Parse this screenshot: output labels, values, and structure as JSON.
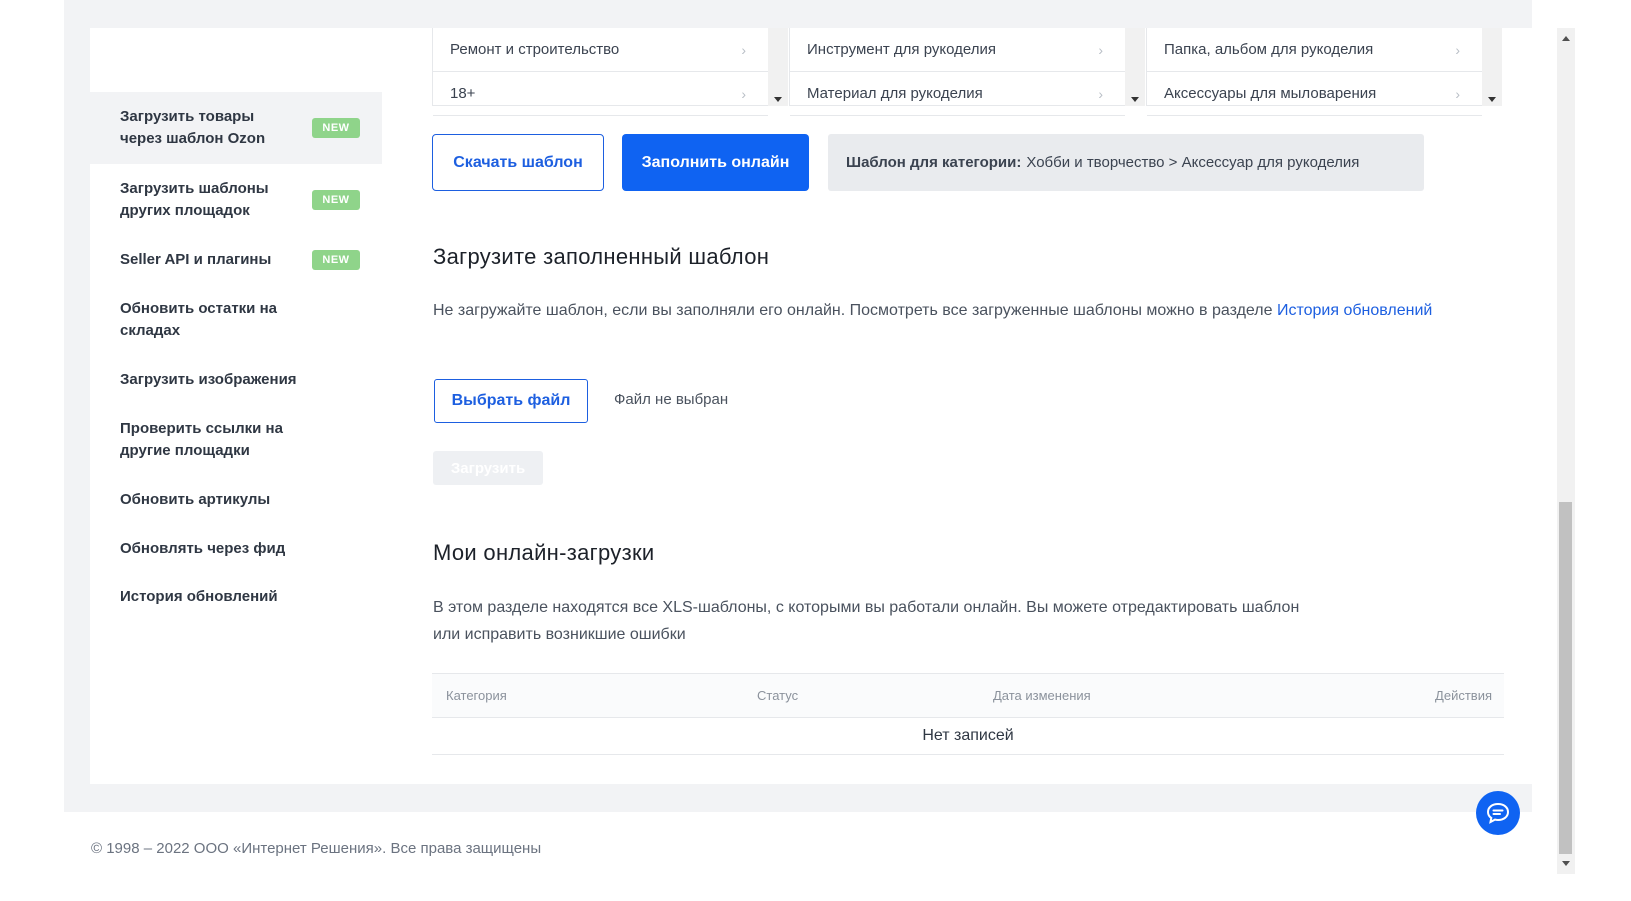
{
  "sidebar": {
    "items": [
      {
        "label": "Загрузить товары через шаблон Ozon",
        "badge": "NEW"
      },
      {
        "label": "Загрузить шаблоны других площадок",
        "badge": "NEW"
      },
      {
        "label": "Seller API и плагины",
        "badge": "NEW"
      },
      {
        "label": "Обновить остатки на складах"
      },
      {
        "label": "Загрузить изображения"
      },
      {
        "label": "Проверить ссылки на другие площадки"
      },
      {
        "label": "Обновить артикулы"
      },
      {
        "label": "Обновлять через фид"
      },
      {
        "label": "История обновлений"
      }
    ]
  },
  "categories": {
    "col1": [
      "Ремонт и строительство",
      "18+"
    ],
    "col2": [
      "Инструмент для рукоделия",
      "Материал для рукоделия"
    ],
    "col3": [
      "Папка, альбом для рукоделия",
      "Аксессуары для мыловарения"
    ]
  },
  "actions": {
    "download_label": "Скачать шаблон",
    "fill_online_label": "Заполнить онлайн",
    "template_for_label": "Шаблон для категории:",
    "template_for_value": "Хобби и творчество > Аксессуар для рукоделия"
  },
  "upload": {
    "title": "Загрузите заполненный шаблон",
    "text": "Не загружайте шаблон, если вы заполняли его онлайн. Посмотреть все загруженные шаблоны можно в разделе ",
    "link": "История обновлений",
    "choose_file_label": "Выбрать файл",
    "file_status": "Файл не выбран",
    "upload_label": "Загрузить"
  },
  "online": {
    "title": "Мои онлайн-загрузки",
    "text_line1": "В этом разделе находятся все XLS-шаблоны, с которыми вы работали онлайн. Вы можете отредактировать шаблон",
    "text_line2": "или исправить возникшие ошибки",
    "columns": [
      "Категория",
      "Статус",
      "Дата изменения",
      "Действия"
    ],
    "empty": "Нет записей"
  },
  "footer": "© 1998 – 2022 ООО «Интернет Решения». Все права защищены",
  "colors": {
    "accent": "#0f63f2",
    "badge": "#8fd48a"
  }
}
